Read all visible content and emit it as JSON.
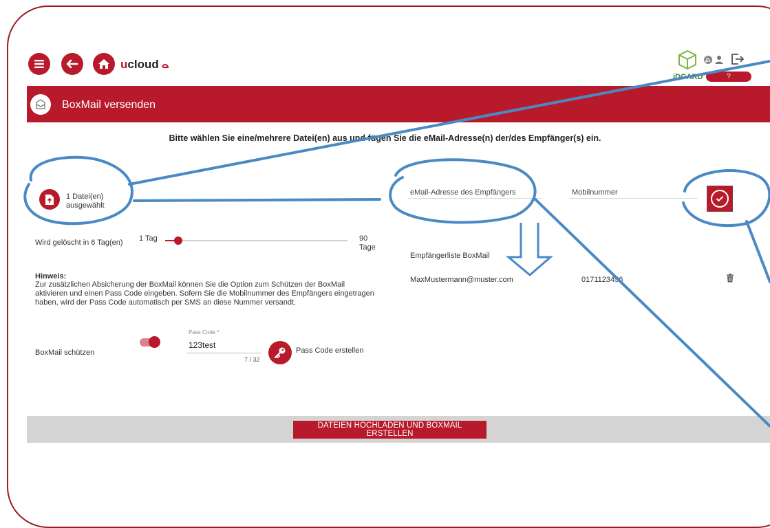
{
  "colors": {
    "brand": "#b81a2c",
    "annotation": "#4a8ac4",
    "frame": "#9c1a22"
  },
  "topbar": {
    "logo_u": "u",
    "logo_text": "cloud",
    "brand_text": "iDGARD",
    "user_time": "?",
    "icons": [
      "menu-icon",
      "back-arrow-icon",
      "home-icon",
      "rss-icon",
      "user-icon",
      "logout-icon"
    ]
  },
  "header": {
    "title": "BoxMail versenden"
  },
  "instruction": "Bitte wählen Sie eine/mehrere Datei(en) aus und fügen Sie die eMail-Adresse(n) der/des Empfänger(s) ein.",
  "upload": {
    "line1": "1 Datei(en)",
    "line2": "ausgewählt"
  },
  "deletion": {
    "label": "Wird gelöscht in 6 Tag(en)",
    "min_label": "1 Tag",
    "max_value": "90",
    "max_unit": "Tage",
    "value_days": 6
  },
  "hint": {
    "title": "Hinweis:",
    "line1": "Zur zusätzlichen Absicherung der BoxMail können Sie die Option zum Schützen der BoxMail",
    "line2": "aktivieren und einen Pass Code eingeben. Sofern Sie die Mobilnummer des Empfängers eingetragen",
    "line3": "haben, wird der Pass Code automatisch per SMS an diese Nummer versandt."
  },
  "protect": {
    "label": "BoxMail schützen",
    "enabled": true,
    "passcode_label": "Pass Code *",
    "passcode_value": "123test",
    "counter": "7 / 32",
    "create_label": "Pass Code erstellen"
  },
  "recipient": {
    "email_placeholder": "eMail-Adresse des Empfängers",
    "mobile_placeholder": "Mobilnummer",
    "list_title": "Empfängerliste BoxMail",
    "entries": [
      {
        "email": "MaxMustermann@muster.com",
        "mobile": "0171123456"
      }
    ]
  },
  "submit_label": "DATEIEN HOCHLADEN UND BOXMAIL ERSTELLEN"
}
